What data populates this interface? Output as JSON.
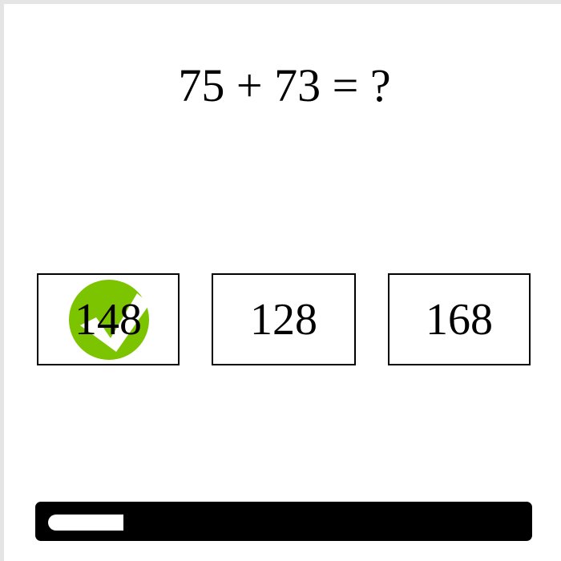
{
  "question": {
    "text": "75 + 73 = ?"
  },
  "choices": [
    {
      "label": "148",
      "state": "correct",
      "icon": "check-icon"
    },
    {
      "label": "128",
      "state": "unselected"
    },
    {
      "label": "168",
      "state": "unselected"
    }
  ],
  "progress": {
    "fraction": 0.16
  },
  "colors": {
    "correct": "#7cc400",
    "frame": "#e5e5e5",
    "progress_track": "#000000",
    "progress_fill": "#ffffff"
  }
}
